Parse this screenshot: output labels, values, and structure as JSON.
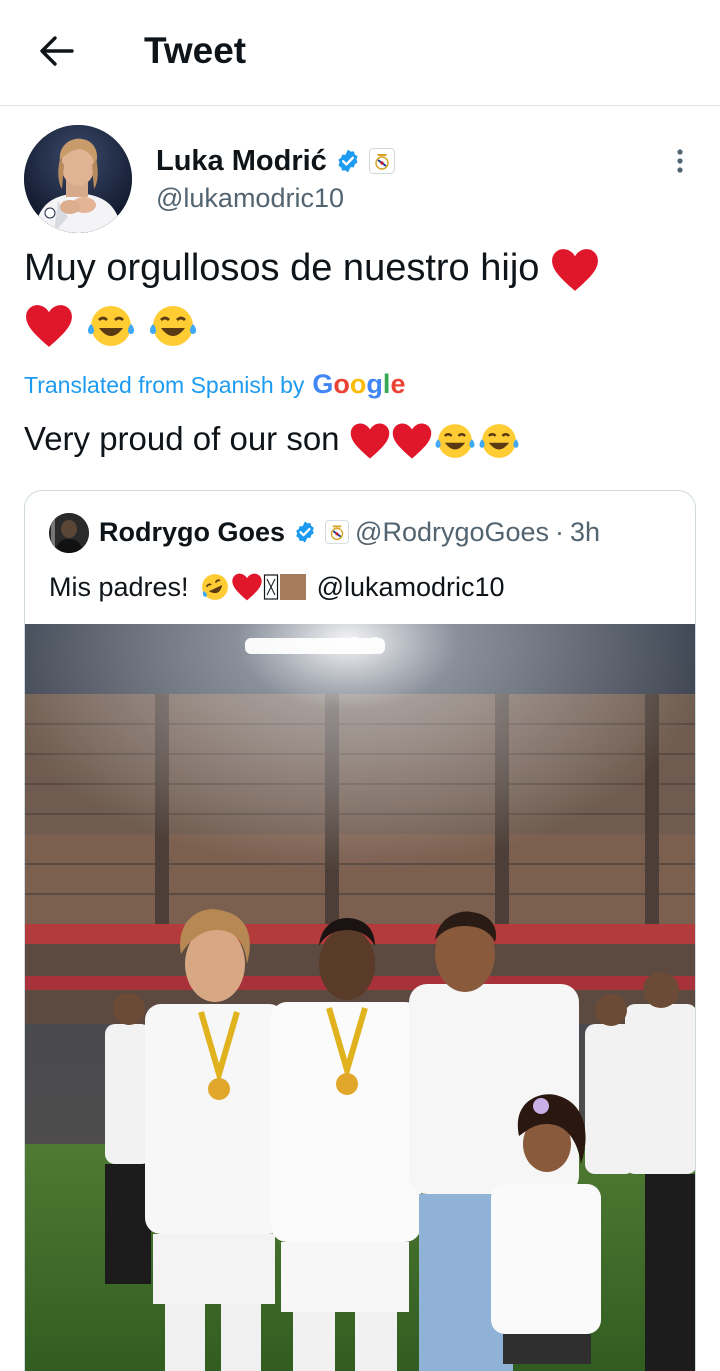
{
  "header": {
    "title": "Tweet"
  },
  "tweet": {
    "author_name": "Luka Modrić",
    "handle": "@lukamodric10",
    "text": "Muy orgullosos de nuestro hijo",
    "translated_label": "Translated from Spanish by",
    "translator_logo": "Google",
    "translation": "Very proud of our son"
  },
  "quote": {
    "author_name": "Rodrygo Goes",
    "handle": "@RodrygoGoes",
    "separator": "·",
    "time": "3h",
    "text": "Mis padres!",
    "mention": "@lukamodric10"
  },
  "icons": {
    "back": "back-arrow-icon",
    "verified": "verified-badge-icon",
    "affiliate": "real-madrid-crest-icon",
    "more": "more-vertical-icon",
    "heart": "red-heart-emoji",
    "laugh": "tears-of-joy-emoji",
    "rofl": "rolling-laughing-emoji"
  },
  "colors": {
    "link": "#1d9bf0",
    "verified": "#1d9bf0",
    "text": "#0f1419",
    "secondary": "#536471",
    "heart": "#e0162b",
    "border": "#cfd9de"
  }
}
